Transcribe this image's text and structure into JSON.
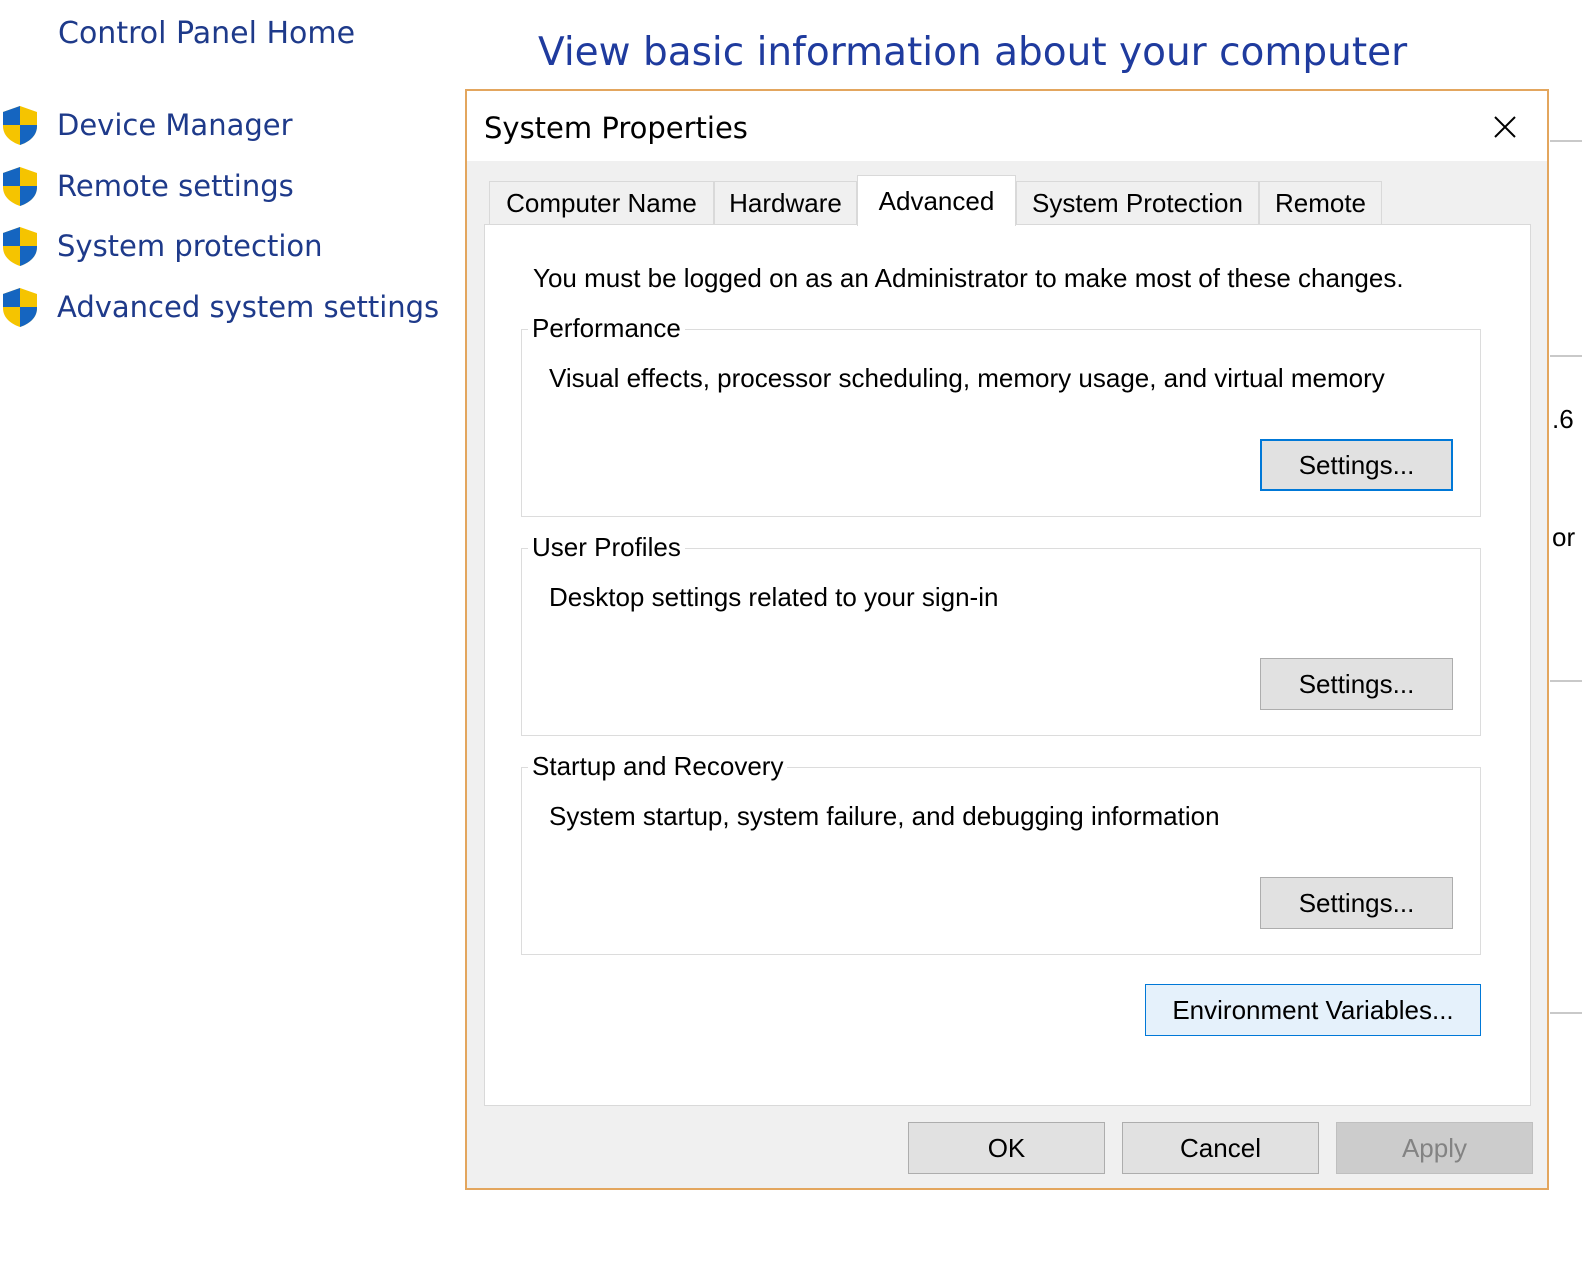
{
  "sidebar": {
    "home": "Control Panel Home",
    "links": [
      "Device Manager",
      "Remote settings",
      "System protection",
      "Advanced system settings"
    ]
  },
  "page": {
    "title": "View basic information about your computer"
  },
  "background_fragments": [
    ".6",
    "or"
  ],
  "dialog": {
    "title": "System Properties",
    "tabs": [
      "Computer Name",
      "Hardware",
      "Advanced",
      "System Protection",
      "Remote"
    ],
    "active_tab": "Advanced",
    "admin_note": "You must be logged on as an Administrator to make most of these changes.",
    "groups": [
      {
        "label": "Performance",
        "desc": "Visual effects, processor scheduling, memory usage, and virtual memory",
        "button": "Settings..."
      },
      {
        "label": "User Profiles",
        "desc": "Desktop settings related to your sign-in",
        "button": "Settings..."
      },
      {
        "label": "Startup and Recovery",
        "desc": "System startup, system failure, and debugging information",
        "button": "Settings..."
      }
    ],
    "env_button": "Environment Variables...",
    "ok": "OK",
    "cancel": "Cancel",
    "apply": "Apply"
  },
  "colors": {
    "accent": "#0078d7",
    "dialog_border": "#e3a65e",
    "link": "#1e3a8a"
  },
  "icons": {
    "sidebar": "uac-shield-icon",
    "close": "close-icon"
  }
}
